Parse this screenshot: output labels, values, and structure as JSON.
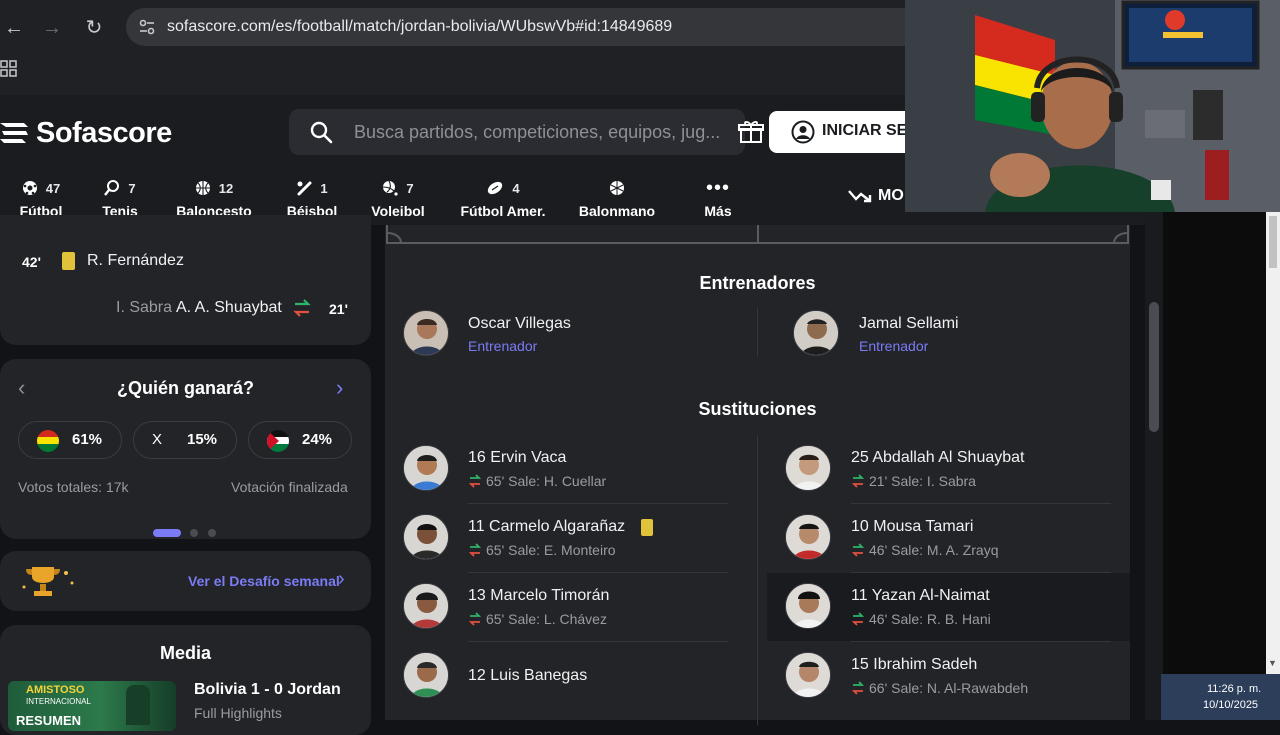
{
  "browser": {
    "url": "sofascore.com/es/football/match/jordan-bolivia/WUbswVb#id:14849689"
  },
  "header": {
    "logo_text": "Sofascore",
    "search_placeholder": "Busca partidos, competiciones, equipos, jug...",
    "login_label": "INICIAR SE",
    "more_label": "MO"
  },
  "sports": [
    {
      "label": "Fútbol",
      "count": "47",
      "icon": "football-icon"
    },
    {
      "label": "Tenis",
      "count": "7",
      "icon": "tennis-icon"
    },
    {
      "label": "Baloncesto",
      "count": "12",
      "icon": "basketball-icon"
    },
    {
      "label": "Béisbol",
      "count": "1",
      "icon": "baseball-icon"
    },
    {
      "label": "Voleibol",
      "count": "7",
      "icon": "volleyball-icon"
    },
    {
      "label": "Fútbol Amer.",
      "count": "4",
      "icon": "american-football-icon"
    },
    {
      "label": "Balonmano",
      "count": "",
      "icon": "handball-icon"
    },
    {
      "label": "Más",
      "count": "",
      "icon": "more-dots-icon"
    }
  ],
  "events": [
    {
      "minute": "42'",
      "player": "R. Fernández",
      "type": "yellow-card"
    },
    {
      "minute": "21'",
      "player_out": "I. Sabra",
      "player_in": "A. A. Shuaybat",
      "type": "substitution"
    }
  ],
  "prediction": {
    "title": "¿Quién ganará?",
    "options": [
      {
        "label": "61%",
        "team": "bolivia-flag"
      },
      {
        "label": "15%",
        "prefix": "X"
      },
      {
        "label": "24%",
        "team": "jordan-flag"
      }
    ],
    "total_votes": "Votos totales: 17k",
    "status": "Votación finalizada"
  },
  "challenge": {
    "label": "Ver el Desafío semanal"
  },
  "media": {
    "title": "Media",
    "item_title": "Bolivia 1 - 0 Jordan",
    "item_subtitle": "Full Highlights",
    "thumb_text_1": "AMISTOSO",
    "thumb_text_2": "INTERNACIONAL",
    "thumb_text_3": "RESUMEN"
  },
  "coaches": {
    "title": "Entrenadores",
    "home": {
      "name": "Oscar Villegas",
      "role": "Entrenador"
    },
    "away": {
      "name": "Jamal Sellami",
      "role": "Entrenador"
    }
  },
  "substitutions": {
    "title": "Sustituciones",
    "home": [
      {
        "name": "16 Ervin Vaca",
        "detail": "65' Sale:  H. Cuellar",
        "card": false
      },
      {
        "name": "11 Carmelo Algarañaz",
        "detail": "65' Sale:  E. Monteiro",
        "card": true
      },
      {
        "name": "13 Marcelo Timorán",
        "detail": "65' Sale:  L. Chávez",
        "card": false
      },
      {
        "name": "12 Luis Banegas",
        "detail": "",
        "card": false
      }
    ],
    "away": [
      {
        "name": "25 Abdallah Al Shuaybat",
        "detail": "21' Sale:  I. Sabra"
      },
      {
        "name": "10 Mousa Tamari",
        "detail": "46' Sale:  M. A. Zrayq"
      },
      {
        "name": "11 Yazan Al-Naimat",
        "detail": "46' Sale:  R. B. Hani"
      },
      {
        "name": "15 Ibrahim Sadeh",
        "detail": "66' Sale:  N. Al-Rawabdeh"
      }
    ]
  },
  "taskbar": {
    "time": "11:26 p. m.",
    "date": "10/10/2025"
  },
  "colors": {
    "accent": "#7b7cf5",
    "card_yellow": "#e0c23b",
    "sub_green": "#2fb36b",
    "sub_red": "#e3503f"
  }
}
